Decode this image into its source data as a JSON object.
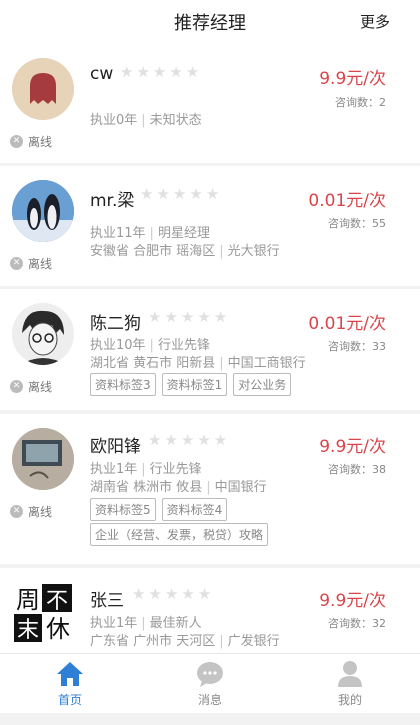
{
  "header": {
    "title": "推荐经理",
    "more": "更多"
  },
  "managers": [
    {
      "name": "cw",
      "price": "9.9元/次",
      "consult": "咨询数：2",
      "status": "离线",
      "exp": "执业0年",
      "title": "未知状态",
      "location": "",
      "bank": "",
      "tags": []
    },
    {
      "name": "mr.梁",
      "price": "0.01元/次",
      "consult": "咨询数：55",
      "status": "离线",
      "exp": "执业11年",
      "title": "明星经理",
      "location": "安徽省 合肥市 瑶海区",
      "bank": "光大银行",
      "tags": []
    },
    {
      "name": "陈二狗",
      "price": "0.01元/次",
      "consult": "咨询数：33",
      "status": "离线",
      "exp": "执业10年",
      "title": "行业先锋",
      "location": "湖北省 黄石市 阳新县",
      "bank": "中国工商银行",
      "tags": [
        "资料标签3",
        "资料标签1",
        "对公业务"
      ]
    },
    {
      "name": "欧阳锋",
      "price": "9.9元/次",
      "consult": "咨询数：38",
      "status": "离线",
      "exp": "执业1年",
      "title": "行业先锋",
      "location": "湖南省 株洲市 攸县",
      "bank": "中国银行",
      "tags": [
        "资料标签5",
        "资料标签4"
      ],
      "tags2": [
        "企业（经营、发票，税贷）攻略"
      ]
    },
    {
      "name": "张三",
      "price": "9.9元/次",
      "consult": "咨询数：32",
      "status": "",
      "exp": "执业1年",
      "title": "最佳新人",
      "location": "广东省 广州市 天河区",
      "bank": "广发银行",
      "tags": [],
      "avatar_text": [
        "周",
        "不",
        "末",
        "休"
      ]
    }
  ],
  "tabs": [
    {
      "label": "首页",
      "icon": "home-icon",
      "active": true
    },
    {
      "label": "消息",
      "icon": "message-icon",
      "active": false
    },
    {
      "label": "我的",
      "icon": "profile-icon",
      "active": false
    }
  ],
  "colors": {
    "price": "#d9454a",
    "accent": "#2f7fd6"
  }
}
